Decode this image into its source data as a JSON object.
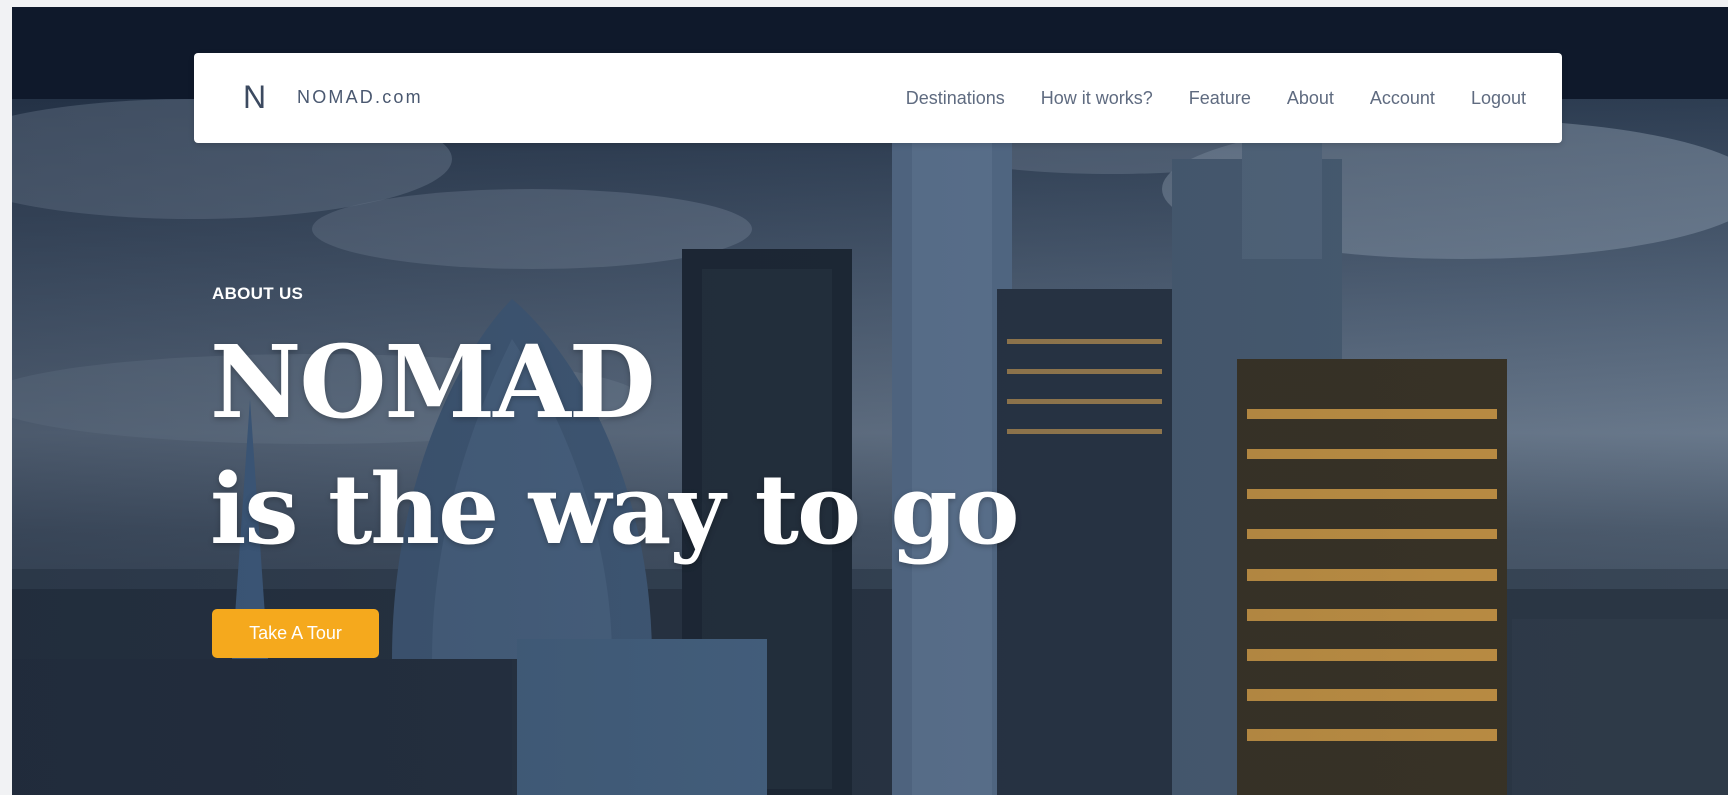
{
  "brand": {
    "mark": "N",
    "name": "NOMAD.com"
  },
  "nav": {
    "links": [
      "Destinations",
      "How it works?",
      "Feature",
      "About",
      "Account",
      "Logout"
    ]
  },
  "hero": {
    "eyebrow": "ABOUT US",
    "headline_line1": "NOMAD",
    "headline_line2": "is the way to go",
    "cta_label": "Take A Tour"
  },
  "colors": {
    "page_dark": "#0f192b",
    "accent": "#f5a91d",
    "nav_text": "#5f6b80"
  }
}
